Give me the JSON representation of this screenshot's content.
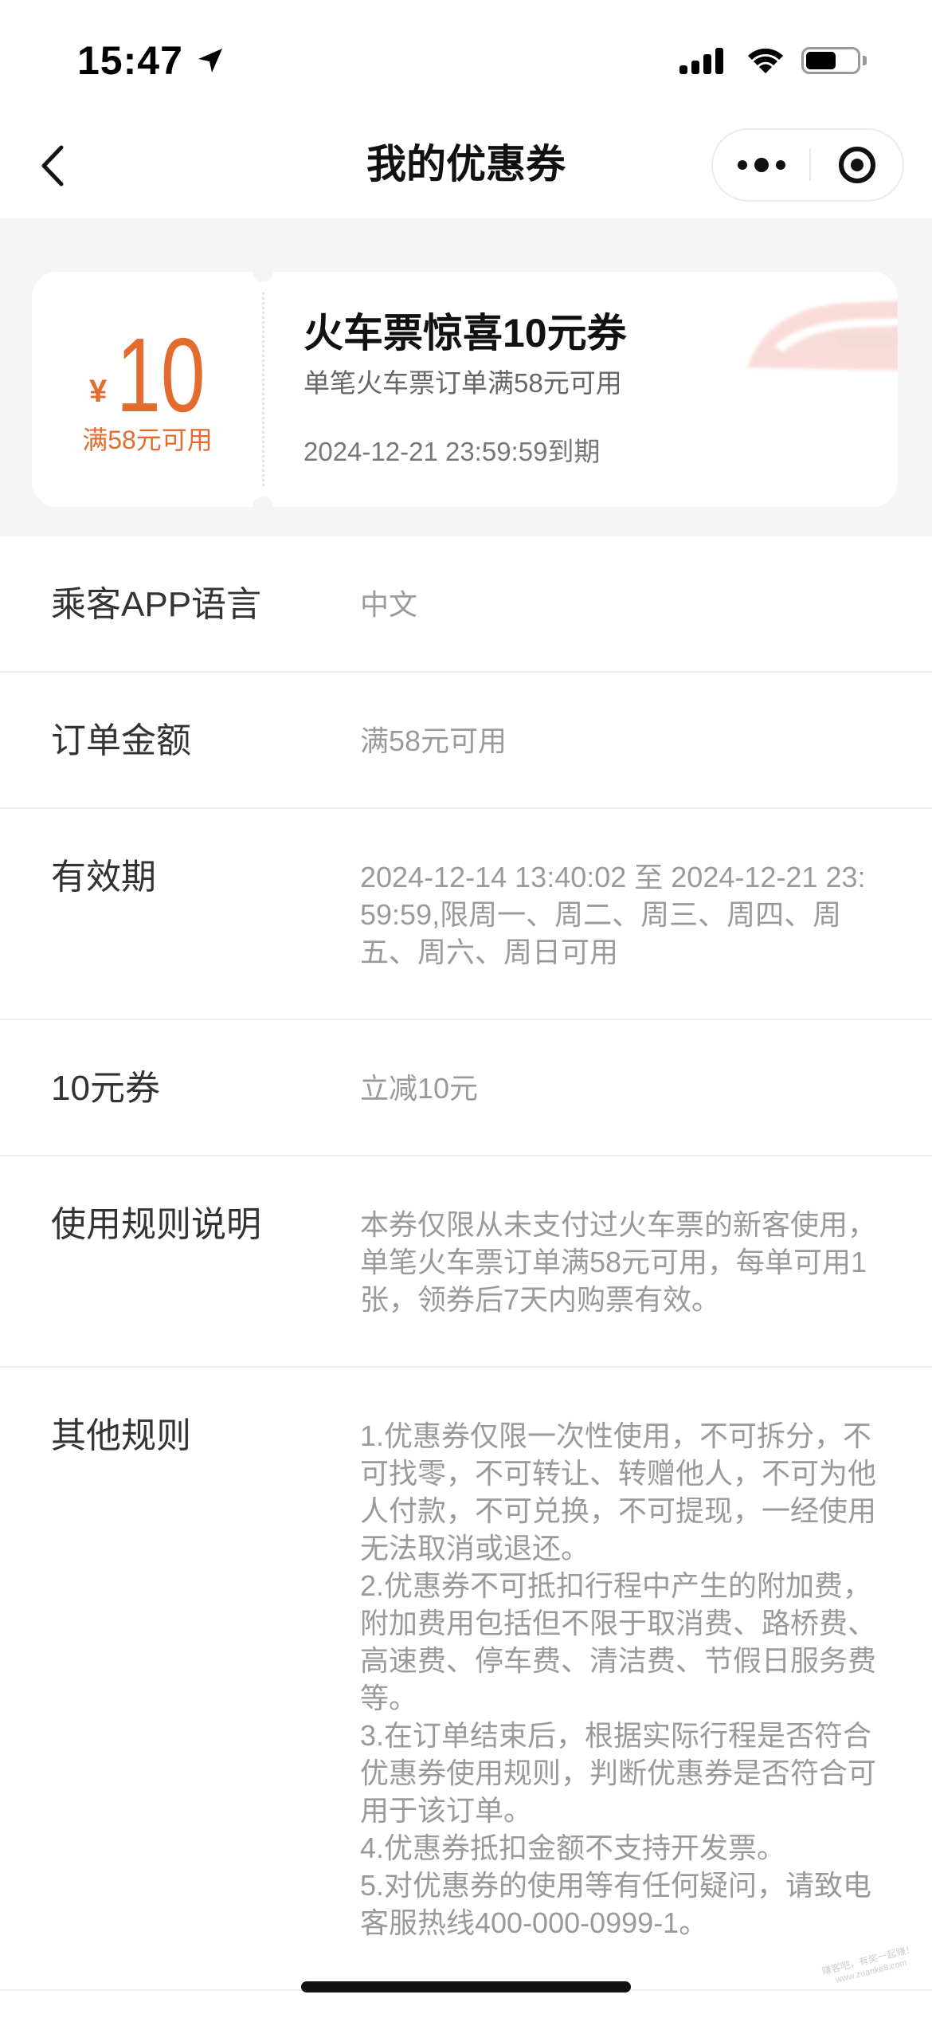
{
  "status_bar": {
    "time": "15:47",
    "battery_level": 0.6
  },
  "nav": {
    "title": "我的优惠券"
  },
  "coupon": {
    "currency": "¥",
    "amount": "10",
    "threshold": "满58元可用",
    "title": "火车票惊喜10元券",
    "condition": "单笔火车票订单满58元可用",
    "expiry": "2024-12-21 23:59:59到期"
  },
  "details": [
    {
      "label": "乘客APP语言",
      "value": "中文"
    },
    {
      "label": "订单金额",
      "value": "满58元可用"
    },
    {
      "label": "有效期",
      "value": "2024-12-14 13:40:02 至 2024-12-21 23:59:59,限周一、周二、周三、周四、周五、周六、周日可用"
    },
    {
      "label": "10元券",
      "value": "立减10元"
    },
    {
      "label": "使用规则说明",
      "value": "本券仅限从未支付过火车票的新客使用，单笔火车票订单满58元可用，每单可用1张，领券后7天内购票有效。"
    },
    {
      "label": "其他规则",
      "paragraphs": [
        "1.优惠券仅限一次性使用，不可拆分，不可找零，不可转让、转赠他人，不可为他人付款，不可兑换，不可提现，一经使用无法取消或退还。",
        "2.优惠券不可抵扣行程中产生的附加费，附加费用包括但不限于取消费、路桥费、高速费、停车费、清洁费、节假日服务费等。",
        "3.在订单结束后，根据实际行程是否符合优惠券使用规则，判断优惠券是否符合可用于该订单。",
        "4.优惠券抵扣金额不支持开发票。",
        "5.对优惠券的使用等有任何疑问，请致电客服热线400-000-0999-1。"
      ]
    }
  ],
  "watermark": {
    "line1": "赚客吧，有奖一起赚！",
    "line2": "www.zuanke8.com"
  },
  "icons": {
    "location": "location-arrow-icon",
    "signal": "signal-icon",
    "wifi": "wifi-icon",
    "battery": "battery-icon",
    "back": "chevron-left-icon",
    "more": "more-dots-icon",
    "close": "target-circle-icon",
    "coupon_image": "train-image"
  },
  "colors": {
    "accent": "#e26b2d",
    "section_background": "#f5f5f5",
    "label_text": "#333333",
    "value_text": "#9a9a9a"
  }
}
